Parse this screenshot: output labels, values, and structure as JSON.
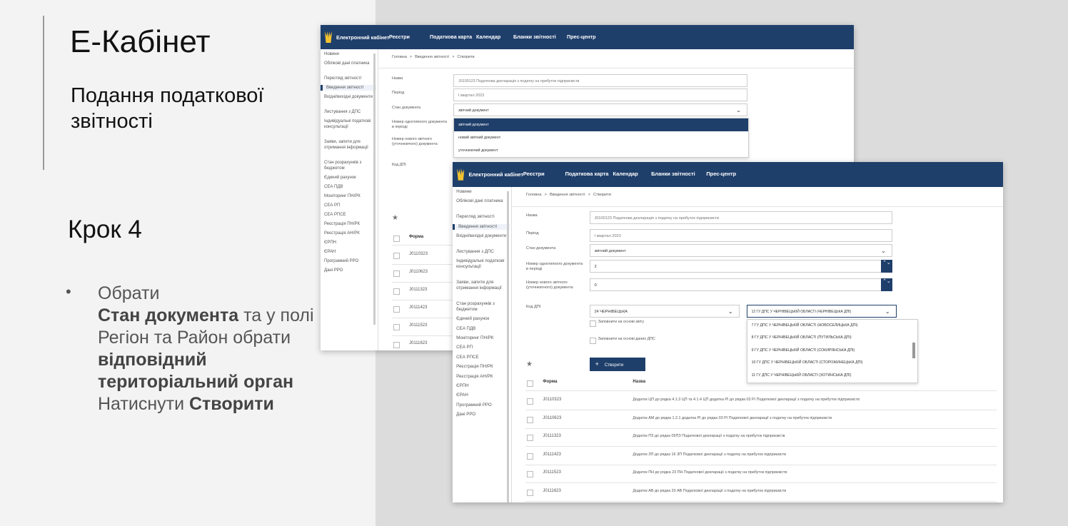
{
  "slide": {
    "title": "Е-Кабінет",
    "subtitle": "Подання податкової звітності",
    "step": "Крок 4",
    "bullet": {
      "t1": "Обрати",
      "b1": "Стан документа",
      "t2": " та у полі Регіон та Район обрати ",
      "b2": "відповідний територіальний орган",
      "t3": "Натиснути ",
      "b3": "Створити"
    }
  },
  "app": {
    "nav": [
      "Електронний кабінет",
      "Реєстри",
      "Податкова карта",
      "Календар",
      "Бланки звітності",
      "Прес-центр"
    ],
    "sidebar": [
      "Новини",
      "Облікові дані платника",
      "Перегляд звітності",
      "Введення звітності",
      "Вхідні/вихідні документи",
      "Листування з ДПС",
      "Індивідуальні податкові консультації",
      "Заяви, запити для отримання інформації",
      "Стан розрахунків з бюджетом",
      "Єдиний рахунок",
      "СЕА ПДВ",
      "Моніторинг ПН/РК",
      "СЕА РП",
      "СЕА РПСЕ",
      "Реєстрація ПН/РК",
      "Реєстрація АН/РК",
      "ЄРПН",
      "ЄРАН",
      "Програмний РРО",
      "Дані РРО"
    ],
    "breadcrumb": {
      "home": "Головна",
      "section": "Введення звітності",
      "page": "Створити",
      "sep": ">"
    },
    "labels": {
      "name": "Назва",
      "period": "Період",
      "state": "Стан документа",
      "num_same": "Номер однотипного документа в періоді",
      "num_new": "Номер нового звітного (уточнюючого) документа",
      "dpi": "Код ДПІ"
    },
    "values": {
      "name": "J0100123 Податкова декларація з податку на прибуток підприємств",
      "period": "I квартал 2023",
      "state": "звітний документ",
      "num_same": "2",
      "num_new": "0",
      "region": "24 ЧЕРНІВЕЦЬКА",
      "district": "12 ГУ ДПС У ЧЕРНІВЕЦЬКІЙ ОБЛАСТІ (ЧЕРНІВЕЦЬКА ДПІ)"
    },
    "state_options": [
      "звітний документ",
      "новий звітний документ",
      "уточнюючий документ"
    ],
    "district_options": [
      "7 ГУ ДПС У ЧЕРНІВЕЦЬКІЙ ОБЛАСТІ (НОВОСЕЛИЦЬКА ДПІ)",
      "8 ГУ ДПС У ЧЕРНІВЕЦЬКІЙ ОБЛАСТІ (ПУТИЛЬСЬКА ДПІ)",
      "9 ГУ ДПС У ЧЕРНІВЕЦЬКІЙ ОБЛАСТІ (СОКИРЯНСЬКА ДПІ)",
      "10 ГУ ДПС У ЧЕРНІВЕЦЬКІЙ ОБЛАСТІ (СТОРОЖИНЕЦЬКА ДПІ)",
      "11 ГУ ДПС У ЧЕРНІВЕЦЬКІЙ ОБЛАСТІ (ХОТИНСЬКА ДПІ)"
    ],
    "checks": {
      "report": "Заповнити на основі звіту",
      "dps": "Заповнити на основі даних ДПС"
    },
    "create": "Створити",
    "table": {
      "col_form": "Форма",
      "col_name": "Назва",
      "rows": [
        {
          "form": "J0110323",
          "name": "Додаток ЦП до рядка 4.1.3 ЦП та 4.1.4 ЦП додатка РІ до рядка 03 РІ Податкової декларації з податку на прибуток підприємств"
        },
        {
          "form": "J0110623",
          "name": "Додаток АМ до рядка 1.2.1 додатка РІ до рядка 03 РІ Податкової декларації з податку на прибуток підприємств"
        },
        {
          "form": "J0111323",
          "name": "Додаток ПЗ до рядка 05ПЗ Податкової декларації з податку на прибуток підприємств"
        },
        {
          "form": "J0111423",
          "name": "Додаток ЗП до рядка 16 ЗП Податкової декларації з податку на прибуток підприємств"
        },
        {
          "form": "J0111523",
          "name": "Додаток ПН до рядка 23 ПН Податкової декларації з податку на прибуток підприємств"
        },
        {
          "form": "J0111623",
          "name": "Додаток АВ до рядка 20 АВ Податкової декларації з податку на прибуток підприємств"
        }
      ]
    },
    "star": "★",
    "plus": "+"
  }
}
